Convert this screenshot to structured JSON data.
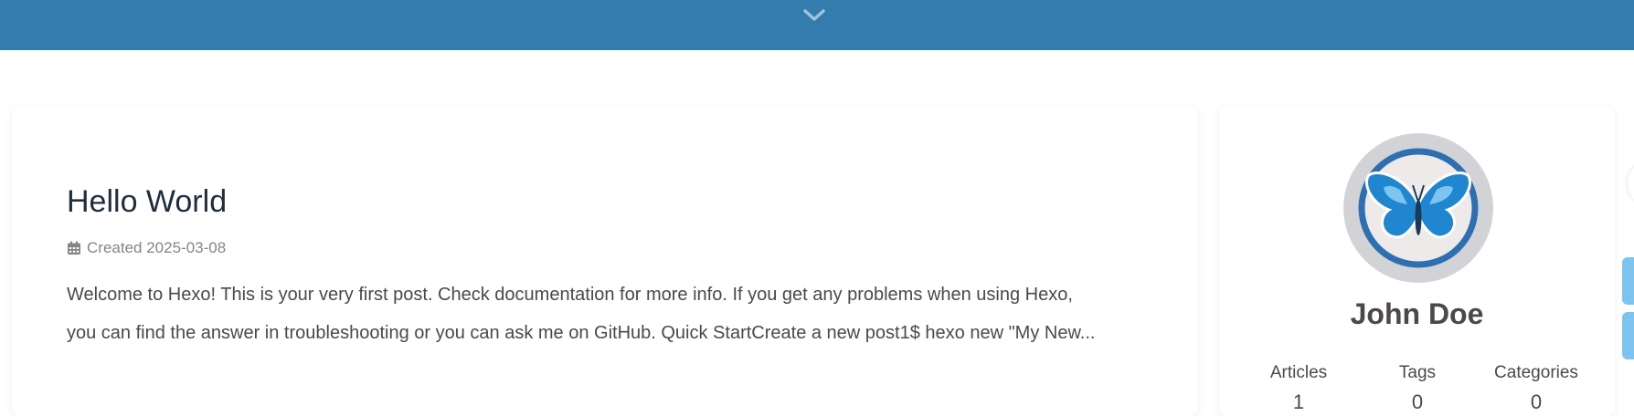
{
  "colors": {
    "header_band": "#347cad",
    "title_text": "#1f2d3d",
    "body_text": "#4c4948",
    "meta_text": "#858585",
    "side_button": "#7ec4f0"
  },
  "header": {
    "scroll_icon": "chevron-down-icon"
  },
  "post": {
    "title": "Hello World",
    "meta": {
      "icon": "calendar-icon",
      "created_label": "Created",
      "created_date": "2025-03-08"
    },
    "excerpt_lines": [
      "Welcome to Hexo! This is your very first post. Check documentation for more info. If you get any problems when using Hexo,",
      "you can find the answer in troubleshooting or you can ask me on GitHub. Quick StartCreate a new post1$ hexo new \"My New..."
    ]
  },
  "profile": {
    "avatar_icon": "butterfly-logo-icon",
    "name": "John Doe",
    "stats": [
      {
        "label": "Articles",
        "value": "1"
      },
      {
        "label": "Tags",
        "value": "0"
      },
      {
        "label": "Categories",
        "value": "0"
      }
    ]
  }
}
